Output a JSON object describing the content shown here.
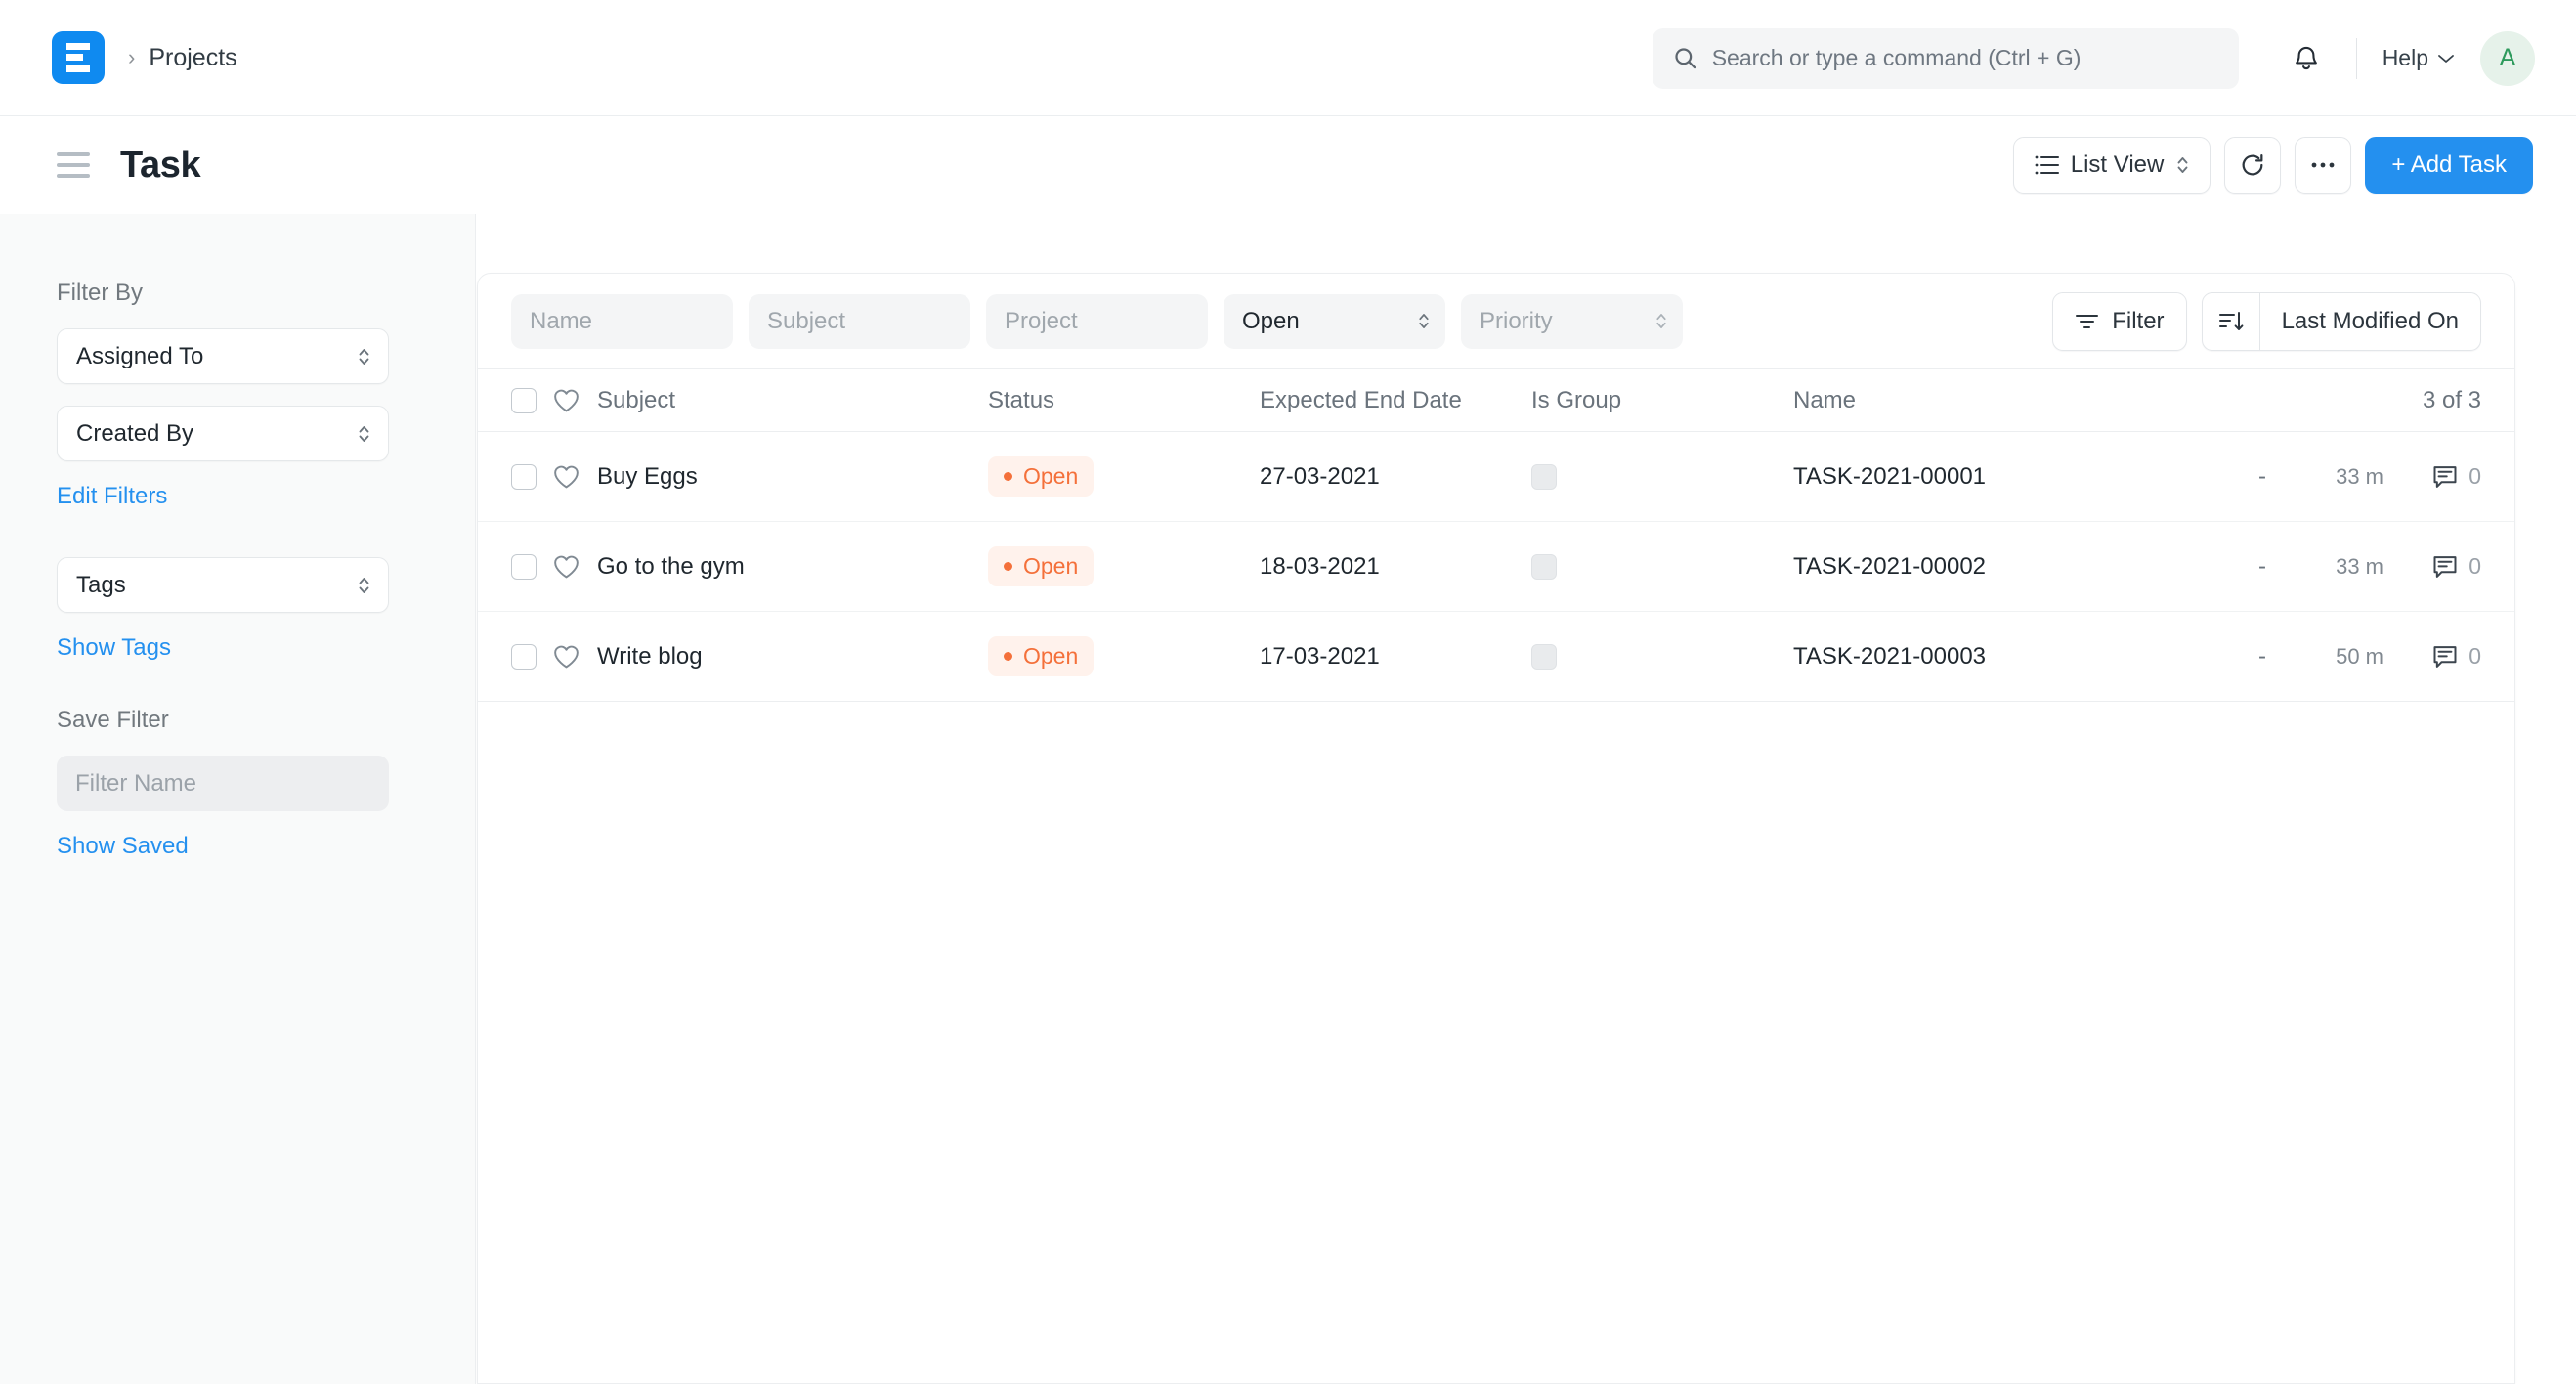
{
  "navbar": {
    "logo_icon": "frappe-logo-icon",
    "breadcrumb_separator": "›",
    "breadcrumb": "Projects",
    "search": {
      "placeholder": "Search or type a command (Ctrl + G)",
      "value": "",
      "icon": "search-icon"
    },
    "notifications_icon": "bell-icon",
    "help_label": "Help",
    "help_chevron": "⌄",
    "avatar_initial": "A",
    "avatar_bg": "#e6f2ea",
    "avatar_color": "#2d9a5c"
  },
  "page_head": {
    "menu_icon": "hamburger-icon",
    "title": "Task",
    "view_button": {
      "label": "List View",
      "icon": "list-icon",
      "chevron": "⌃⌄"
    },
    "refresh_icon": "refresh-icon",
    "more_label": "•••",
    "add_button": "+ Add Task",
    "accent": "#2490ef"
  },
  "sidebar": {
    "filter_by_label": "Filter By",
    "assigned_to": "Assigned To",
    "created_by": "Created By",
    "edit_filters": "Edit Filters",
    "tags": "Tags",
    "show_tags": "Show Tags",
    "save_filter_label": "Save Filter",
    "filter_name_placeholder": "Filter Name",
    "filter_name_value": "",
    "show_saved": "Show Saved",
    "link_color": "#2490ef"
  },
  "filters": {
    "name_placeholder": "Name",
    "subject_placeholder": "Subject",
    "project_placeholder": "Project",
    "status_value": "Open",
    "priority_placeholder": "Priority",
    "filter_button": "Filter",
    "filter_icon": "filter-icon",
    "sort_icon": "sort-descending-icon",
    "sort_label": "Last Modified On"
  },
  "table": {
    "columns": {
      "subject": "Subject",
      "status": "Status",
      "expected_end_date": "Expected End Date",
      "is_group": "Is Group",
      "name": "Name"
    },
    "count_label": "3 of 3",
    "heart_icon": "heart-icon",
    "comment_icon": "comment-icon",
    "status_badge_bg": "#fff2ec",
    "status_badge_color": "#f4703a",
    "rows": [
      {
        "subject": "Buy Eggs",
        "status": "Open",
        "expected_end_date": "27-03-2021",
        "is_group": false,
        "name": "TASK-2021-00001",
        "dash": "-",
        "modified": "33 m",
        "comments": "0"
      },
      {
        "subject": "Go to the gym",
        "status": "Open",
        "expected_end_date": "18-03-2021",
        "is_group": false,
        "name": "TASK-2021-00002",
        "dash": "-",
        "modified": "33 m",
        "comments": "0"
      },
      {
        "subject": "Write blog",
        "status": "Open",
        "expected_end_date": "17-03-2021",
        "is_group": false,
        "name": "TASK-2021-00003",
        "dash": "-",
        "modified": "50 m",
        "comments": "0"
      }
    ]
  }
}
